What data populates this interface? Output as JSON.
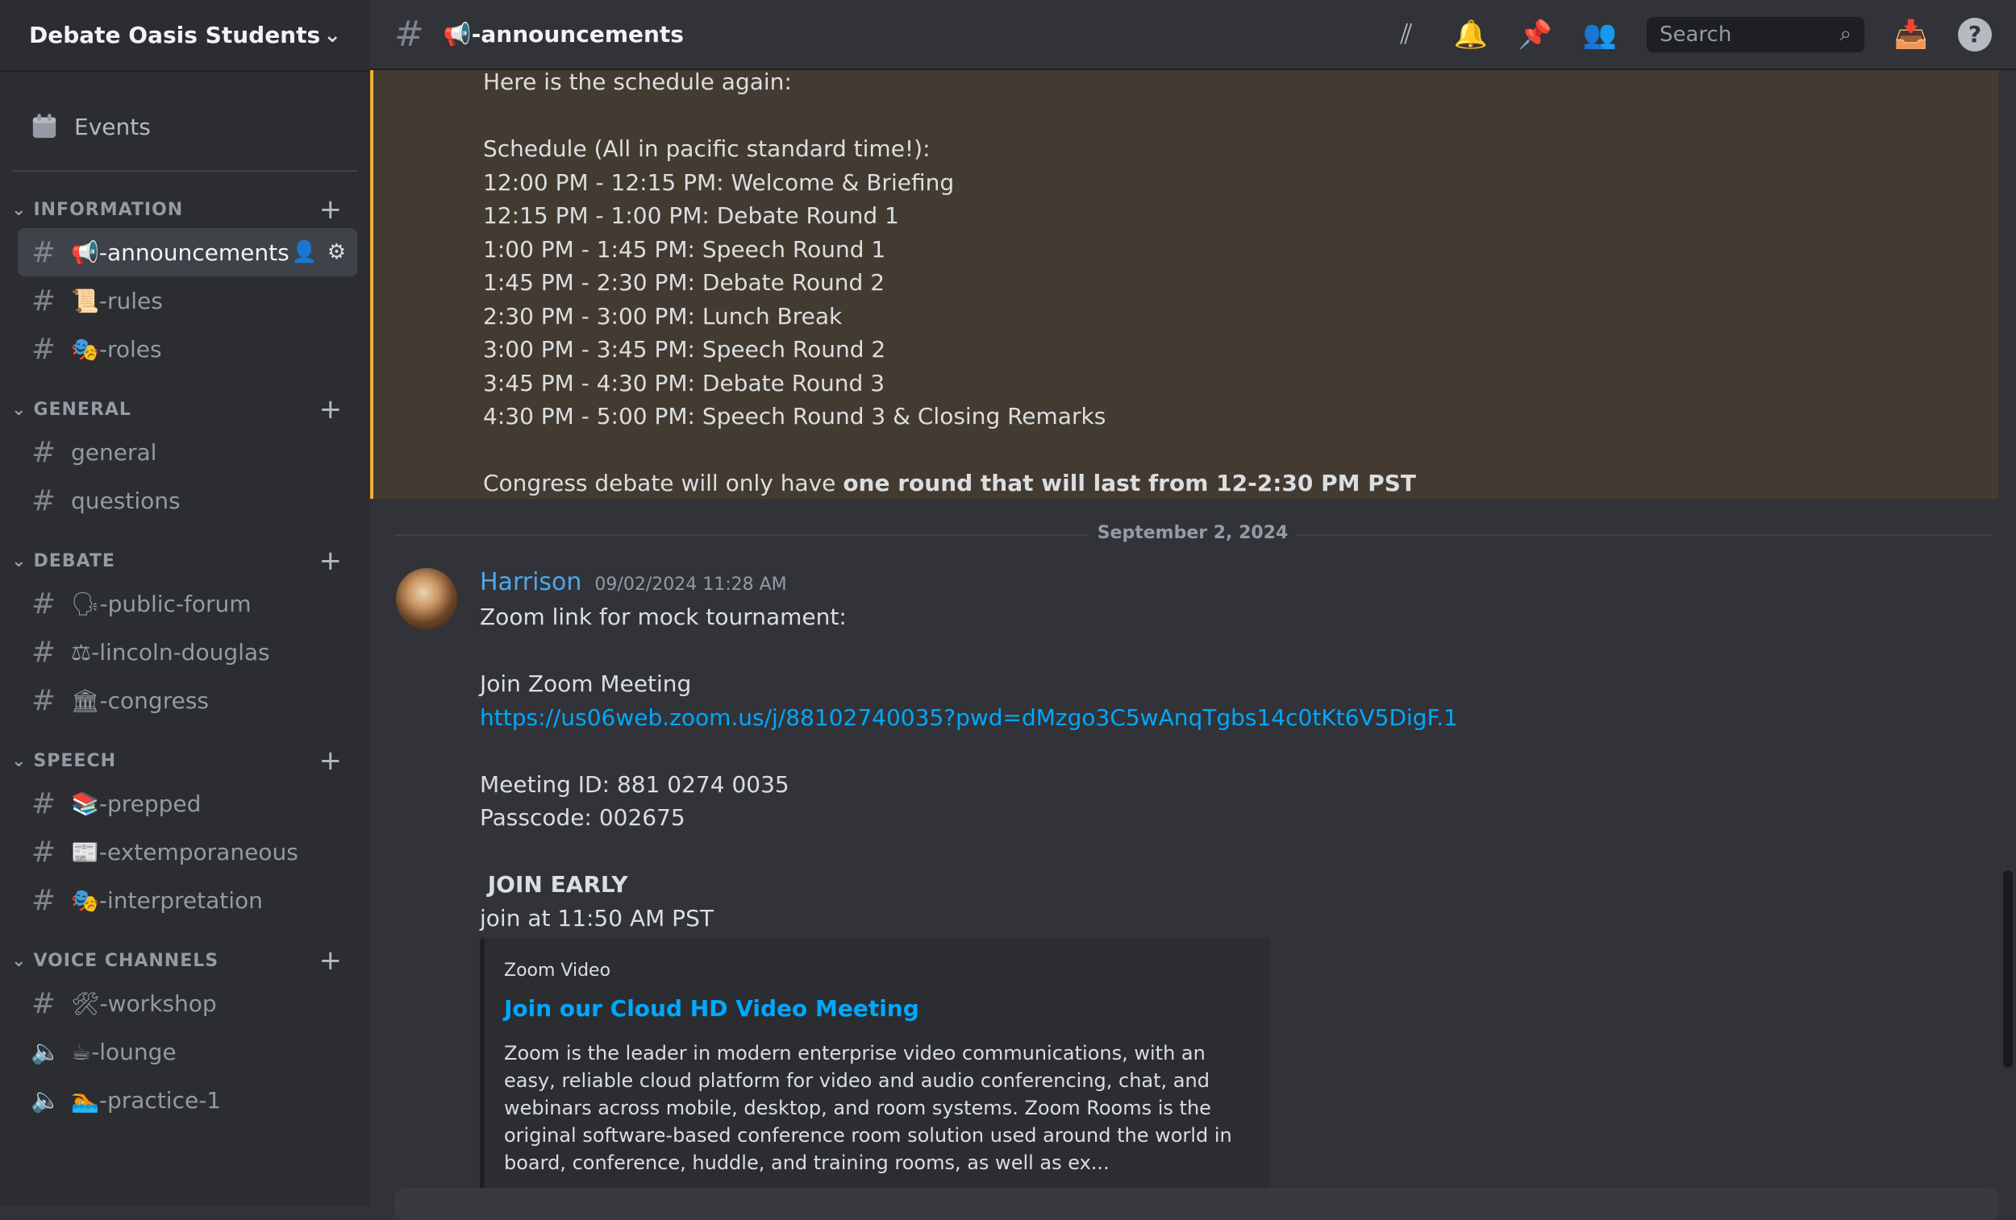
{
  "server": {
    "name": "Debate Oasis Students"
  },
  "sidebar": {
    "events_label": "Events",
    "categories": [
      {
        "name": "INFORMATION",
        "channels": [
          {
            "icon": "📢",
            "name": "-announcements",
            "active": true
          },
          {
            "icon": "📜",
            "name": "-rules"
          },
          {
            "icon": "🎭",
            "name": "-roles"
          }
        ]
      },
      {
        "name": "GENERAL",
        "channels": [
          {
            "icon": "",
            "name": "general"
          },
          {
            "icon": "",
            "name": "questions"
          }
        ]
      },
      {
        "name": "DEBATE",
        "channels": [
          {
            "icon": "🗣",
            "name": "-public-forum"
          },
          {
            "icon": "⚖",
            "name": "-lincoln-douglas"
          },
          {
            "icon": "🏛",
            "name": "-congress"
          }
        ]
      },
      {
        "name": "SPEECH",
        "channels": [
          {
            "icon": "📚",
            "name": "-prepped"
          },
          {
            "icon": "📰",
            "name": "-extemporaneous"
          },
          {
            "icon": "🎭",
            "name": "-interpretation"
          }
        ]
      },
      {
        "name": "VOICE CHANNELS",
        "channels": [
          {
            "icon": "🛠",
            "name": "-workshop",
            "type": "text"
          },
          {
            "icon": "☕",
            "name": "-lounge",
            "type": "voice"
          },
          {
            "icon": "🏊",
            "name": "-practice-1",
            "type": "voice"
          }
        ]
      }
    ]
  },
  "header": {
    "channel_icon": "📢",
    "channel_name": "-announcements",
    "search_placeholder": "Search"
  },
  "previous_message": {
    "lines": [
      "Here is the schedule again:",
      "",
      "Schedule (All in pacific standard time!):",
      "12:00 PM - 12:15 PM: Welcome & Briefing",
      "12:15 PM - 1:00 PM: Debate Round 1",
      "1:00 PM - 1:45 PM: Speech Round 1",
      "1:45 PM - 2:30 PM: Debate Round 2",
      "2:30 PM - 3:00 PM: Lunch Break",
      "3:00 PM - 3:45 PM: Speech Round 2",
      "3:45 PM - 4:30 PM: Debate Round 3",
      "4:30 PM - 5:00 PM: Speech Round 3 & Closing Remarks",
      ""
    ],
    "congress_prefix": "Congress debate will only have ",
    "congress_bold": "one round that will last from 12-2:30 PM PST"
  },
  "date_divider": "September 2, 2024",
  "message": {
    "author": "Harrison",
    "timestamp": "09/02/2024 11:28 AM",
    "line1": "Zoom link for mock tournament:",
    "join_label": "Join Zoom Meeting",
    "link": "https://us06web.zoom.us/j/88102740035?pwd=dMzgo3C5wAnqTgbs14c0tKt6V5DigF.1",
    "meeting_id": "Meeting ID: 881 0274 0035",
    "passcode": "Passcode: 002675",
    "join_early": " JOIN EARLY",
    "join_at": "join at 11:50 AM PST"
  },
  "embed": {
    "provider": "Zoom Video",
    "title": "Join our Cloud HD Video Meeting",
    "description": "Zoom is the leader in modern enterprise video communications, with an easy, reliable cloud platform for video and audio conferencing, chat, and webinars across mobile, desktop, and room systems. Zoom Rooms is the original software-based conference room solution used around the world in board, conference, huddle, and training rooms, as well as ex..."
  }
}
